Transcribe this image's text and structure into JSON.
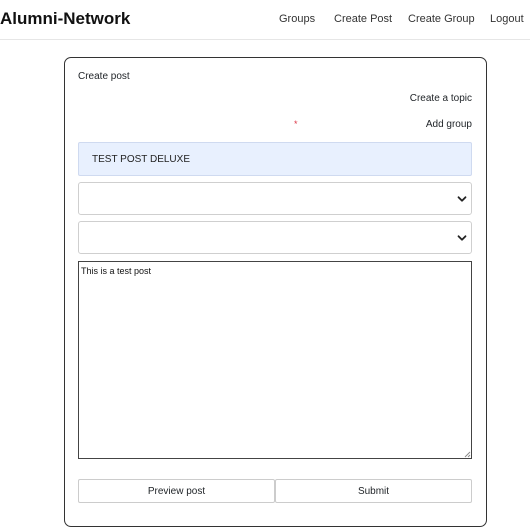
{
  "nav": {
    "brand": "Alumni-Network",
    "links": [
      {
        "label": "Groups"
      },
      {
        "label": "Create Post"
      },
      {
        "label": "Create Group"
      },
      {
        "label": "Logout"
      }
    ]
  },
  "form": {
    "title": "Create post",
    "create_topic_link": "Create a topic",
    "required_marker": "*",
    "add_group_link": "Add group",
    "post_title_value": "TEST POST DELUXE",
    "topic_select_value": "",
    "group_select_value": "",
    "body_value": "This is a test post",
    "preview_button": "Preview post",
    "submit_button": "Submit"
  },
  "icons": {
    "select_arrow": "chevron-down-icon",
    "textarea_grip": "resize-grip-icon"
  },
  "colors": {
    "title_input_bg": "#e8f0fe",
    "required_marker": "#dc3545",
    "card_border": "#333333"
  }
}
